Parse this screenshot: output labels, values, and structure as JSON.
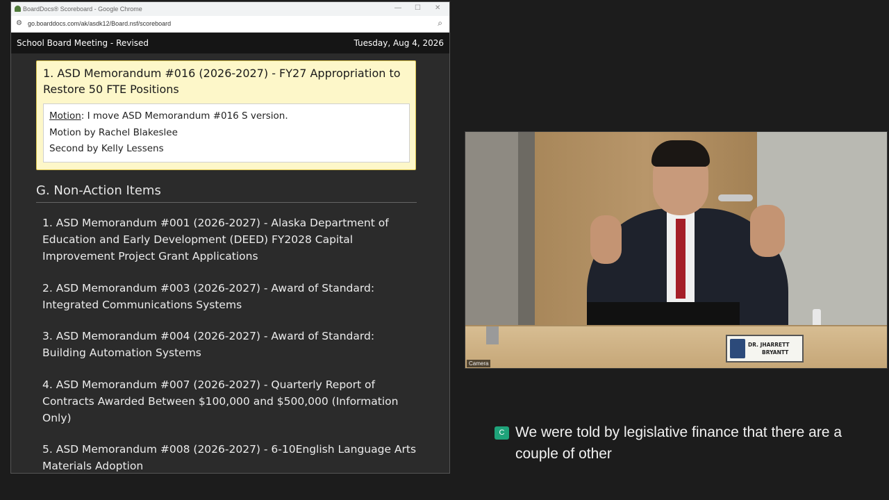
{
  "browser": {
    "tab_title": "BoardDocs® Scoreboard - Google Chrome",
    "url": "go.boarddocs.com/ak/asdk12/Board.nsf/scoreboard",
    "minimize_glyph": "—",
    "maximize_glyph": "☐",
    "close_glyph": "✕",
    "site_settings_icon": "tune-icon",
    "zoom_icon": "zoom-icon"
  },
  "header": {
    "meeting_title": "School Board Meeting - Revised",
    "date": "Tuesday, Aug 4, 2026"
  },
  "current_item": {
    "title": "1. ASD Memorandum #016 (2026-2027) - FY27 Appropriation to Restore 50 FTE Positions",
    "motion_label": "Motion",
    "motion_text": ": I move ASD Memorandum #016 S version.",
    "motion_by": "Motion by Rachel Blakeslee",
    "second_by": "Second by Kelly Lessens"
  },
  "section": {
    "heading": "G. Non-Action Items",
    "items": [
      "1. ASD Memorandum #001 (2026-2027) - Alaska Department of Education and Early Development (DEED) FY2028 Capital Improvement Project Grant Applications",
      "2. ASD Memorandum #003 (2026-2027) - Award of Standard: Integrated Communications Systems",
      "3. ASD Memorandum #004 (2026-2027) - Award of Standard: Building Automation Systems",
      "4. ASD Memorandum #007 (2026-2027) - Quarterly Report of Contracts Awarded Between $100,000 and $500,000 (Information Only)",
      "5. ASD Memorandum #008 (2026-2027) - 6-10English Language Arts Materials Adoption"
    ]
  },
  "video": {
    "camera_label": "Camera",
    "nameplate_line1": "DR. JHARRETT",
    "nameplate_line2": "BRYANTT"
  },
  "caption": {
    "badge": "C",
    "text": "We were told by legislative finance that there are a couple of other"
  },
  "colors": {
    "highlight_bg": "#fdf7c9",
    "cc_badge": "#1fa37a",
    "page_bg": "#2b2b2b"
  }
}
